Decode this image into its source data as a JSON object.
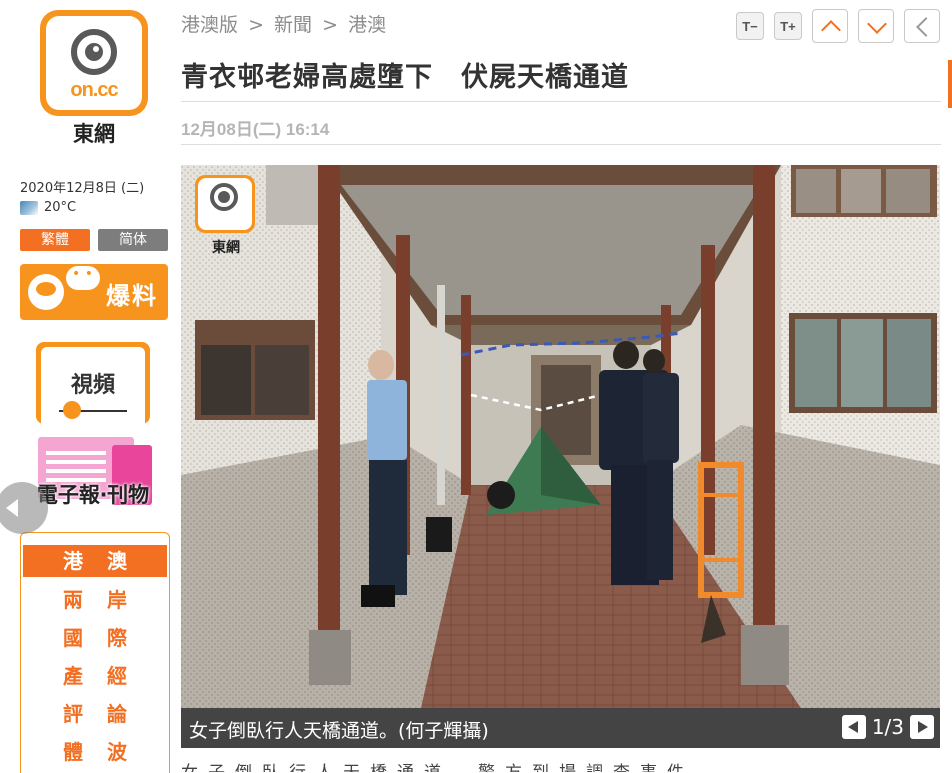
{
  "brand": {
    "logo_text": "on.cc",
    "name": "東網"
  },
  "sidebar": {
    "date": "2020年12月8日 (二)",
    "temperature": "20°C",
    "weather_icon": "cloudy-weather-icon",
    "lang_traditional": "繁體",
    "lang_simplified": "简体",
    "baoliao_label": "爆料",
    "video_label": "視頻",
    "epaper_label": "電子報‧刊物",
    "nav": [
      {
        "label": "港澳",
        "active": true
      },
      {
        "label": "兩岸",
        "active": false
      },
      {
        "label": "國際",
        "active": false
      },
      {
        "label": "產經",
        "active": false
      },
      {
        "label": "評論",
        "active": false
      },
      {
        "label": "體波",
        "active": false
      }
    ]
  },
  "breadcrumb": [
    "港澳版",
    ">",
    "新聞",
    ">",
    "港澳"
  ],
  "toolbar": {
    "font_smaller": "T−",
    "font_larger": "T+"
  },
  "article": {
    "title": "青衣邨老婦高處墮下　伏屍天橋通道",
    "time": "12月08日(二) 16:14"
  },
  "gallery": {
    "caption": "女子倒臥行人天橋通道。(何子輝攝)",
    "counter": "1/3",
    "watermark": "東網"
  },
  "body_preview": "女子倒臥行人天橋通道，警方到場調查事件。",
  "colors": {
    "accent": "#f36f21",
    "logo_orange": "#f7941d",
    "caption_bg": "#444444"
  }
}
